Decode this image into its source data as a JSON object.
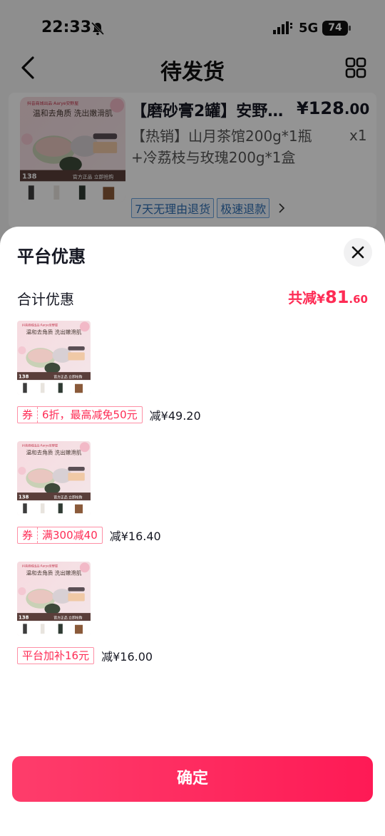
{
  "status_bar": {
    "time": "22:33",
    "network": "5G",
    "battery": "74"
  },
  "nav": {
    "title": "待发货"
  },
  "order": {
    "title": "【磨砂膏2罐】安野…",
    "price_currency": "¥",
    "price_int": "128",
    "price_dec": ".00",
    "spec": "【热销】山月茶馆200g*1瓶+冷荔枝与玫瑰200g*1盒",
    "qty": "x1",
    "service_tags": [
      "7天无理由退货",
      "极速退款"
    ]
  },
  "product_image": {
    "brand": "抖音商城出品·Aarye安野屋",
    "headline": "温和去角质 洗出嫩滑肌",
    "promo_price": "138",
    "promo_banner": "官方正品 立即抢购"
  },
  "sheet": {
    "title": "平台优惠",
    "summary_label": "合计优惠",
    "summary_prefix": "共减",
    "summary_currency": "¥",
    "summary_int": "81",
    "summary_dec": ".60",
    "items": [
      {
        "type": "券",
        "desc": "6折，最高减免50元",
        "amount": "减¥49.20"
      },
      {
        "type": "券",
        "desc": "满300减40",
        "amount": "减¥16.40"
      },
      {
        "type": "",
        "desc": "平台加补16元",
        "amount": "减¥16.00"
      }
    ],
    "confirm_label": "确定"
  },
  "colors": {
    "accent": "#fe2c55",
    "tag_blue": "#2f6fb3",
    "overlay": "rgba(0,0,0,0.42)"
  },
  "icons": [
    "bell-mute-icon",
    "signal-icon",
    "battery-icon",
    "back-arrow-icon",
    "grid-icon",
    "chevron-right-icon",
    "close-icon"
  ]
}
